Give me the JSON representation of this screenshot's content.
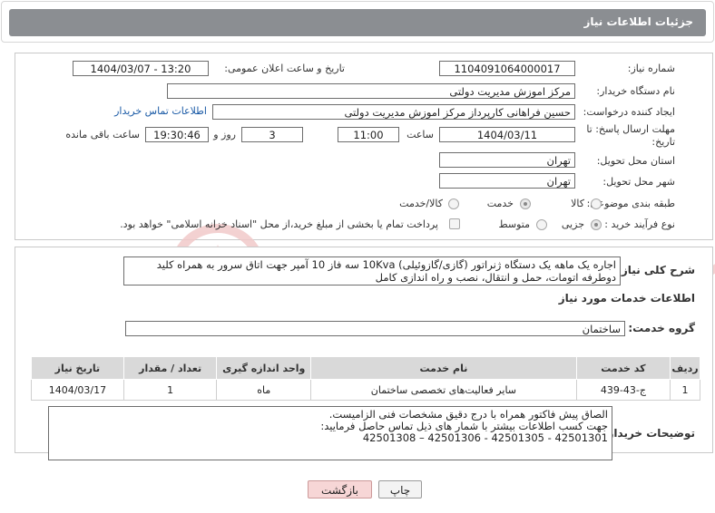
{
  "header": {
    "title": "جزئیات اطلاعات نیاز"
  },
  "fields": {
    "need_number_label": "شماره نیاز:",
    "need_number": "1104091064000017",
    "announce_label": "تاریخ و ساعت اعلان عمومی:",
    "announce_value": "1404/03/07 - 13:20",
    "buyer_org_label": "نام دستگاه خریدار:",
    "buyer_org": "مرکز اموزش مدیریت دولتی",
    "requester_label": "ایجاد کننده درخواست:",
    "requester": "حسین  فراهانی کارپرداز مرکز اموزش مدیریت دولتی",
    "contact_link": "اطلاعات تماس خریدار",
    "deadline_label": "مهلت ارسال پاسخ: تا تاریخ:",
    "deadline_date": "1404/03/11",
    "time_label": "ساعت",
    "deadline_time": "11:00",
    "days_value": "3",
    "days_label": "روز و",
    "remaining_time": "19:30:46",
    "remaining_label": "ساعت باقی مانده",
    "province_label": "استان محل تحویل:",
    "province": "تهران",
    "city_label": "شهر محل تحویل:",
    "city": "تهران",
    "category_label": "طبقه بندی موضوعی:",
    "category_options": [
      "کالا",
      "خدمت",
      "کالا/خدمت"
    ],
    "category_selected": "خدمت",
    "process_label": "نوع فرآیند خرید :",
    "process_options": [
      "جزیی",
      "متوسط"
    ],
    "process_selected": "جزیی",
    "payment_note": "پرداخت تمام یا بخشی از مبلغ خرید،از محل \"اسناد خزانه اسلامی\" خواهد بود."
  },
  "description": {
    "label": "شرح کلی نیاز:",
    "text": "اجاره یک ماهه یک دستگاه ژنراتور (گازی/گازوئیلی) 10Kva سه فاز 10 آمپر جهت اتاق سرور به همراه کلید دوطرفه اتومات، حمل و انتقال، نصب و راه اندازی کامل"
  },
  "services": {
    "section_title": "اطلاعات خدمات مورد نیاز",
    "group_label": "گروه خدمت:",
    "group_value": "ساختمان",
    "columns": [
      "ردیف",
      "کد خدمت",
      "نام خدمت",
      "واحد اندازه گیری",
      "تعداد / مقدار",
      "تاریخ نیاز"
    ],
    "rows": [
      [
        "1",
        "ج-43-439",
        "سایر فعالیت‌های تخصصی ساختمان",
        "ماه",
        "1",
        "1404/03/17"
      ]
    ]
  },
  "buyer_notes": {
    "label": "توضیحات خریدار:",
    "lines": [
      "الصاق پیش فاکتور همراه با درج دقیق مشخصات فنی الزامیست.",
      "جهت کسب اطلاعات بیشتر با شمار های ذیل تماس حاصل فرمایید:",
      "42501301 - 42501305 - 42501306 – 42501308"
    ]
  },
  "buttons": {
    "print": "چاپ",
    "back": "بازگشت"
  },
  "watermark": "AriaTender.neT"
}
